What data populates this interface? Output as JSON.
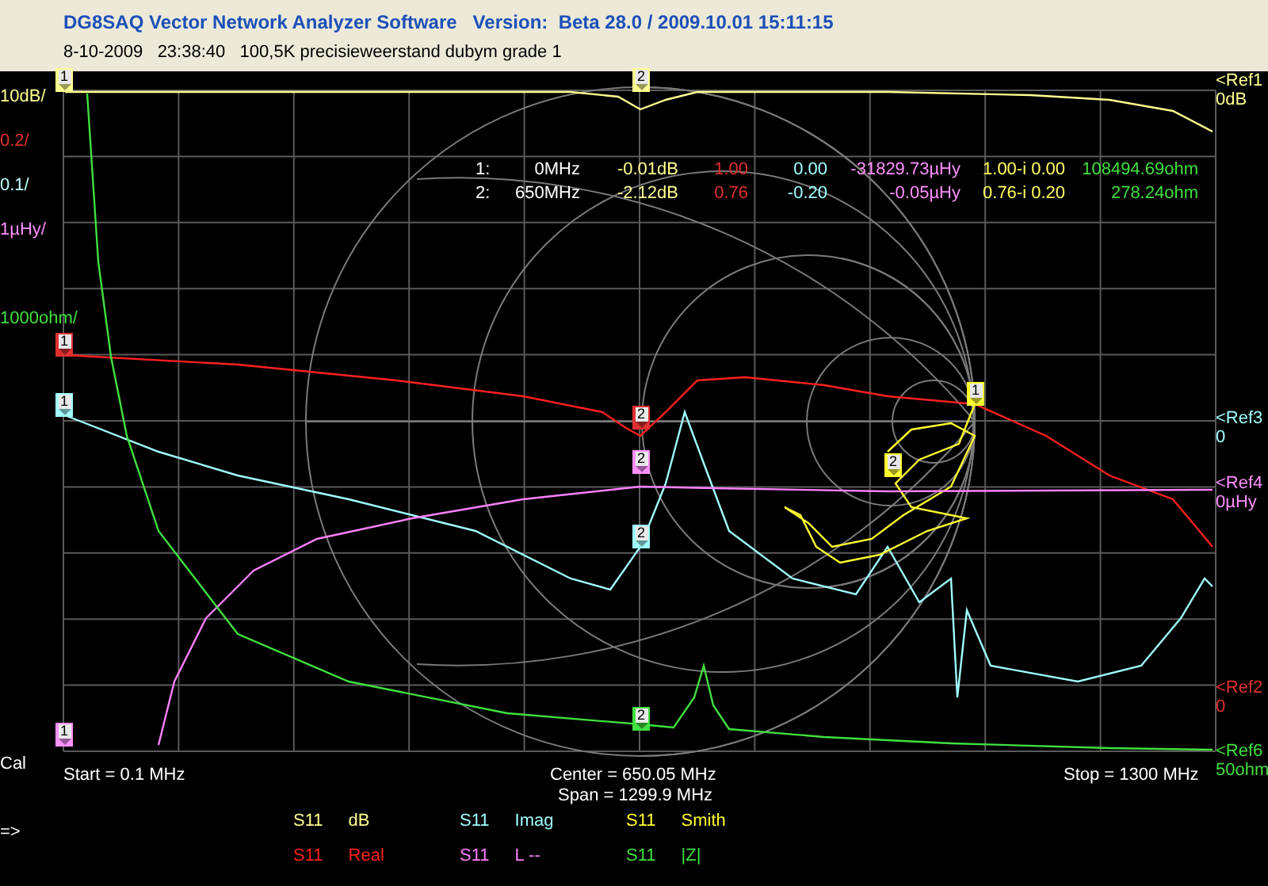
{
  "window": {
    "title": "DG8SAQ Vector Network Analyzer Software   Version:  Beta 28.0 / 2009.10.01 15:11:15",
    "subtitle": "8-10-2009   23:38:40   100,5K precisieweerstand dubym grade 1"
  },
  "scale_labels": [
    {
      "text": "10dB/",
      "color": "#ffff90"
    },
    {
      "text": "0.2/",
      "color": "#e03030"
    },
    {
      "text": "0.1/",
      "color": "#c0ffff"
    },
    {
      "text": "1µHy/",
      "color": "#ff90ff"
    },
    {
      "text": "1000ohm/",
      "color": "#40e040"
    }
  ],
  "references": [
    {
      "name": "<Ref1",
      "value": "0dB",
      "color": "#ffff90"
    },
    {
      "name": "<Ref3",
      "value": "0",
      "color": "#a0ffff"
    },
    {
      "name": "<Ref4",
      "value": "0µHy",
      "color": "#ff90ff"
    },
    {
      "name": "<Ref2",
      "value": "0",
      "color": "#e03030"
    },
    {
      "name": "<Ref6",
      "value": "50ohm",
      "color": "#40e040"
    }
  ],
  "marker_readout": [
    {
      "cells": [
        {
          "text": "1:",
          "color": "#ffffff"
        },
        {
          "text": "0MHz",
          "color": "#ffffff"
        },
        {
          "text": "-0.01dB",
          "color": "#ffff90"
        },
        {
          "text": "1.00",
          "color": "#e03030"
        },
        {
          "text": "0.00",
          "color": "#a0ffff"
        },
        {
          "text": "-31829.73µHy",
          "color": "#ff90ff"
        },
        {
          "text": "1.00-i 0.00",
          "color": "#ffff60"
        },
        {
          "text": "108494.69ohm",
          "color": "#40e040"
        }
      ]
    },
    {
      "cells": [
        {
          "text": "2:",
          "color": "#ffffff"
        },
        {
          "text": "650MHz",
          "color": "#ffffff"
        },
        {
          "text": "-2.12dB",
          "color": "#ffff90"
        },
        {
          "text": "0.76",
          "color": "#e03030"
        },
        {
          "text": "-0.20",
          "color": "#a0ffff"
        },
        {
          "text": "-0.05µHy",
          "color": "#ff90ff"
        },
        {
          "text": "0.76-i 0.20",
          "color": "#ffff60"
        },
        {
          "text": "278.24ohm",
          "color": "#40e040"
        }
      ]
    }
  ],
  "markers": [
    {
      "label": "1",
      "color": "#ffff90"
    },
    {
      "label": "1",
      "color": "#e03030"
    },
    {
      "label": "1",
      "color": "#a0ffff"
    },
    {
      "label": "1",
      "color": "#ff90ff"
    },
    {
      "label": "2",
      "color": "#ffff90"
    },
    {
      "label": "2",
      "color": "#e03030"
    },
    {
      "label": "2",
      "color": "#ff90ff"
    },
    {
      "label": "2",
      "color": "#a0ffff"
    },
    {
      "label": "2",
      "color": "#40e040"
    },
    {
      "label": "1",
      "color": "#ffff30"
    },
    {
      "label": "2",
      "color": "#ffff30"
    }
  ],
  "cal_label": "Cal",
  "sweep": {
    "start": "Start = 0.1 MHz",
    "center": "Center = 650.05 MHz",
    "span": "Span = 1299.9 MHz",
    "stop": "Stop = 1300 MHz"
  },
  "prompt": "=>",
  "legend": [
    {
      "parameter": "S11",
      "format": "dB",
      "color": "#ffff90"
    },
    {
      "parameter": "S11",
      "format": "Imag",
      "color": "#a0ffff"
    },
    {
      "parameter": "S11",
      "format": "Smith",
      "color": "#ffff30"
    },
    {
      "parameter": "S11",
      "format": "Real",
      "color": "#ff2020"
    },
    {
      "parameter": "S11",
      "format": "L --",
      "color": "#ff80ff"
    },
    {
      "parameter": "S11",
      "format": "|Z|",
      "color": "#40e040"
    }
  ]
}
